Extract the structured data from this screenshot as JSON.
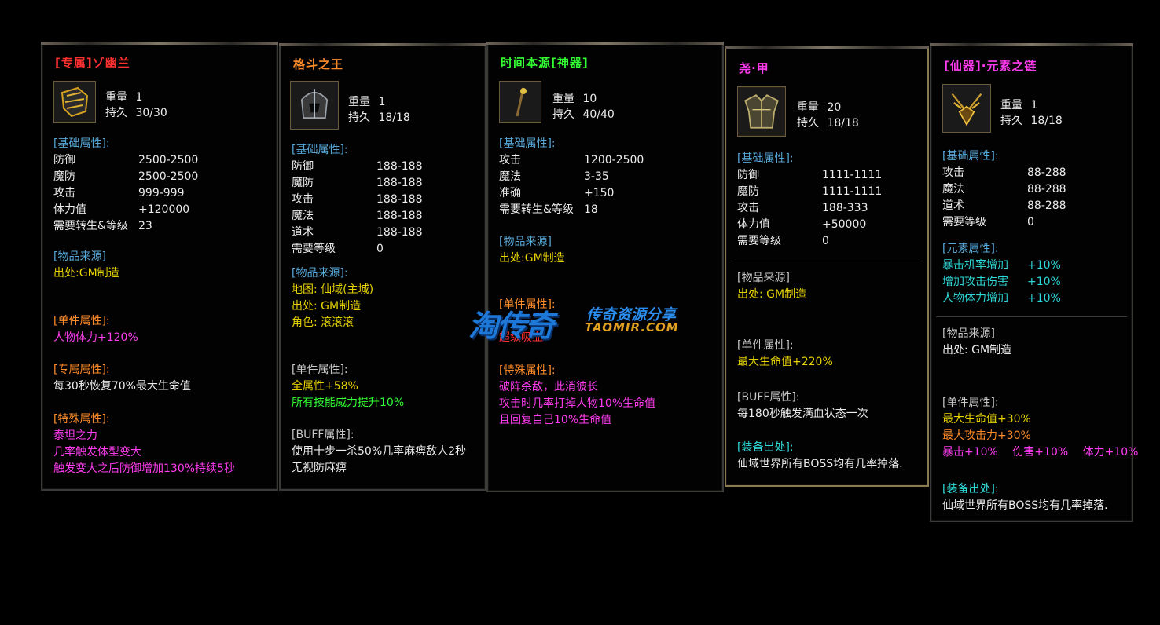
{
  "panels": [
    {
      "title": "[专属]ゾ幽兰",
      "title_color": "#ff2a2a",
      "icon": "armor-icon",
      "weight_label": "重量",
      "weight": "1",
      "durability_label": "持久",
      "durability": "30/30",
      "base_head": "[基础属性]:",
      "base": [
        {
          "k": "防御",
          "v": "2500-2500"
        },
        {
          "k": "魔防",
          "v": "2500-2500"
        },
        {
          "k": "攻击",
          "v": "999-999"
        },
        {
          "k": "体力值",
          "v": "+120000"
        },
        {
          "k": "需要转生&等级",
          "v": "23"
        }
      ],
      "source_head": "[物品来源]",
      "source": [
        "出处:GM制造"
      ],
      "single_head": "[单件属性]:",
      "single": [
        "人物体力+120%"
      ],
      "exclusive_head": "[专属属性]:",
      "exclusive": [
        "每30秒恢复70%最大生命值"
      ],
      "special_head": "[特殊属性]:",
      "special": [
        "泰坦之力",
        "几率触发体型变大",
        "触发变大之后防御增加130%持续5秒"
      ]
    },
    {
      "title": "格斗之王",
      "title_color": "#ff7a1a",
      "icon": "helmet-icon",
      "weight_label": "重量",
      "weight": "1",
      "durability_label": "持久",
      "durability": "18/18",
      "base_head": "[基础属性]:",
      "base": [
        {
          "k": "防御",
          "v": "188-188"
        },
        {
          "k": "魔防",
          "v": "188-188"
        },
        {
          "k": "攻击",
          "v": "188-188"
        },
        {
          "k": "魔法",
          "v": "188-188"
        },
        {
          "k": "道术",
          "v": "188-188"
        },
        {
          "k": "需要等级",
          "v": "0"
        }
      ],
      "source_head": "[物品来源]:",
      "source": [
        "地图: 仙域(主城)",
        "出处: GM制造",
        "角色: 滚滚滚"
      ],
      "single_head": "[单件属性]:",
      "single": [
        "全属性+58%",
        "所有技能威力提升10%"
      ],
      "buff_head": "[BUFF属性]:",
      "buff": [
        "使用十步一杀50%几率麻痹敌人2秒",
        "无视防麻痹"
      ]
    },
    {
      "title": "时间本源[神器]",
      "title_color": "#33ff33",
      "icon": "staff-icon",
      "weight_label": "重量",
      "weight": "10",
      "durability_label": "持久",
      "durability": "40/40",
      "base_head": "[基础属性]:",
      "base": [
        {
          "k": "攻击",
          "v": "1200-2500"
        },
        {
          "k": "魔法",
          "v": "3-35"
        },
        {
          "k": "准确",
          "v": "+150"
        },
        {
          "k": "需要转生&等级",
          "v": "18"
        }
      ],
      "source_head": "[物品来源]",
      "source": [
        "出处:GM制造"
      ],
      "single_head": "[单件属性]:",
      "single": [
        "超级吸血"
      ],
      "special_head": "[特殊属性]:",
      "special": [
        "破阵杀敌，此消彼长",
        "攻击时几率打掉人物10%生命值",
        "且回复自己10%生命值"
      ]
    },
    {
      "title": "尧·甲",
      "title_color": "#ff3cf0",
      "icon": "chest-armor-icon",
      "weight_label": "重量",
      "weight": "20",
      "durability_label": "持久",
      "durability": "18/18",
      "base_head": "[基础属性]:",
      "base": [
        {
          "k": "防御",
          "v": "1111-1111"
        },
        {
          "k": "魔防",
          "v": "1111-1111"
        },
        {
          "k": "攻击",
          "v": "188-333"
        },
        {
          "k": "体力值",
          "v": "+50000"
        },
        {
          "k": "需要等级",
          "v": "0"
        }
      ],
      "source_head": "[物品来源]",
      "source": [
        "出处: GM制造"
      ],
      "single_head": "[单件属性]:",
      "single": [
        "最大生命值+220%"
      ],
      "buff_head": "[BUFF属性]:",
      "buff": [
        "每180秒触发满血状态一次"
      ],
      "drop_head": "[装备出处]:",
      "drop": [
        "仙域世界所有BOSS均有几率掉落."
      ]
    },
    {
      "title": "[仙器]·元素之链",
      "title_color": "#ff3cf0",
      "icon": "necklace-icon",
      "weight_label": "重量",
      "weight": "1",
      "durability_label": "持久",
      "durability": "18/18",
      "base_head": "[基础属性]:",
      "base": [
        {
          "k": "攻击",
          "v": "88-288"
        },
        {
          "k": "魔法",
          "v": "88-288"
        },
        {
          "k": "道术",
          "v": "88-288"
        },
        {
          "k": "需要等级",
          "v": "0"
        }
      ],
      "element_head": "[元素属性]:",
      "element": [
        {
          "k": "暴击机率增加",
          "v": "+10%"
        },
        {
          "k": "增加攻击伤害",
          "v": "+10%"
        },
        {
          "k": "人物体力增加",
          "v": "+10%"
        }
      ],
      "source_head": "[物品来源]",
      "source": [
        "出处: GM制造"
      ],
      "single_head": "[单件属性]:",
      "single": [
        "最大生命值+30%",
        "最大攻击力+30%"
      ],
      "single_extra": [
        "暴击+10%",
        "伤害+10%",
        "体力+10%"
      ],
      "drop_head": "[装备出处]:",
      "drop": [
        "仙域世界所有BOSS均有几率掉落."
      ]
    }
  ],
  "watermark": {
    "logo": "淘传奇",
    "subtitle": "传奇资源分享",
    "url": "TAOMIR.COM"
  }
}
